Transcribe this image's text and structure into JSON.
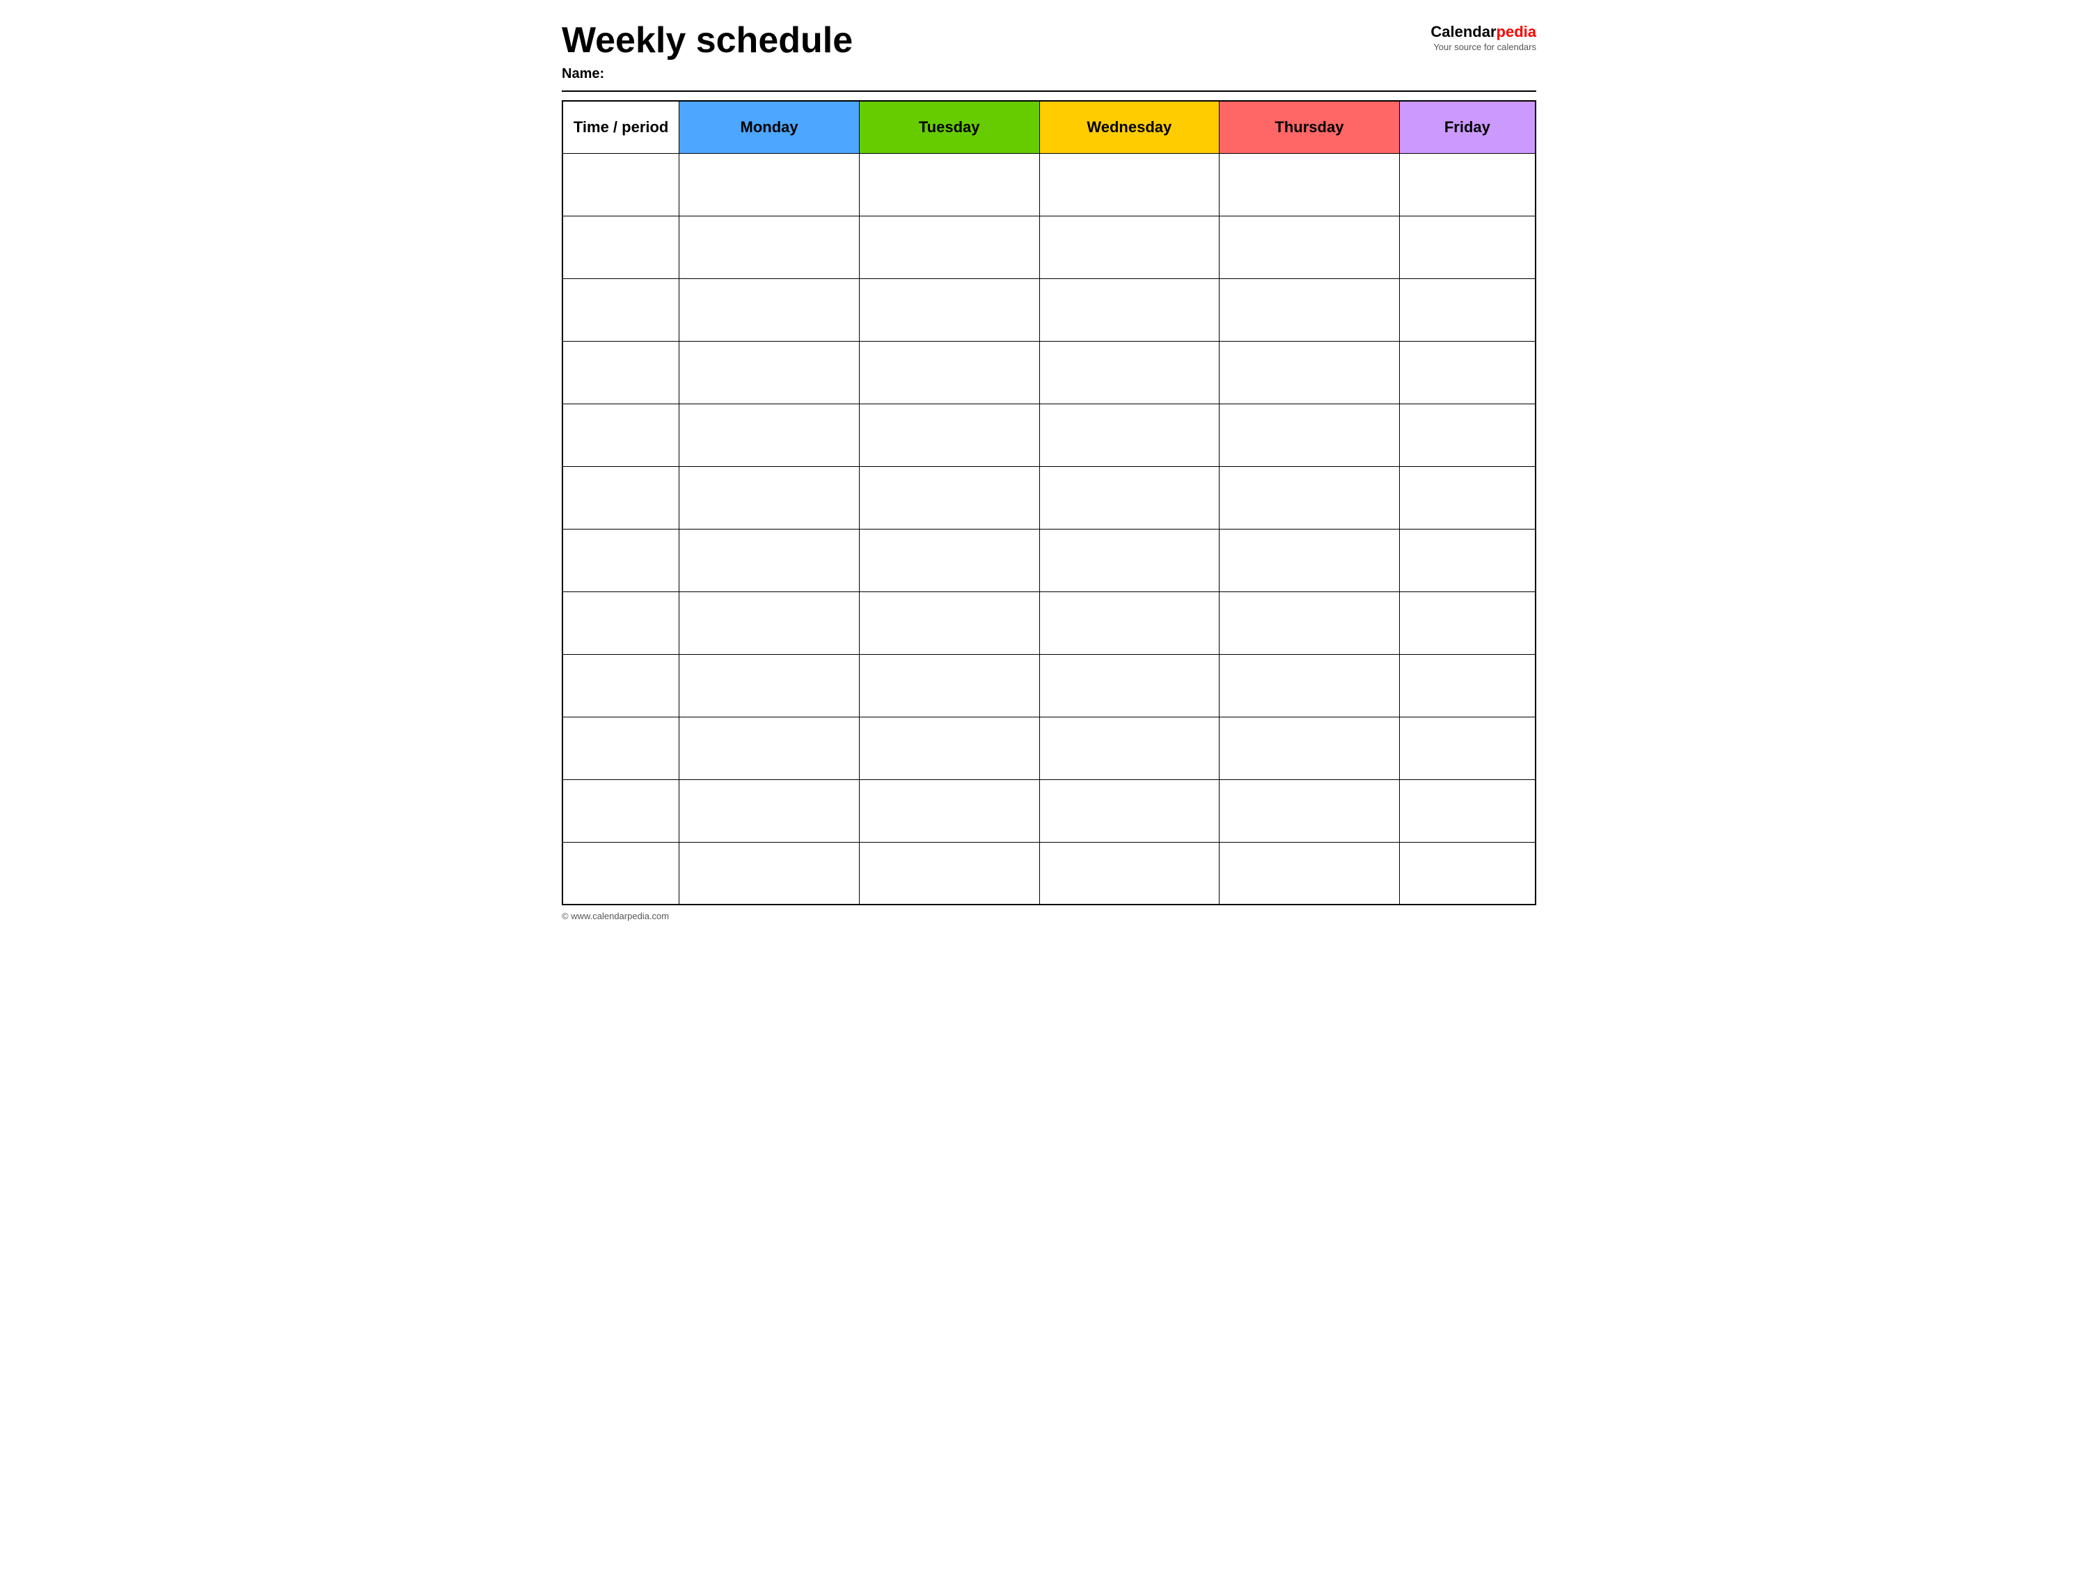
{
  "header": {
    "title": "Weekly schedule",
    "name_label": "Name:",
    "logo_calendar": "Calendar",
    "logo_pedia": "pedia",
    "logo_tagline": "Your source for calendars"
  },
  "table": {
    "columns": [
      {
        "id": "time",
        "label": "Time / period",
        "color": "#ffffff"
      },
      {
        "id": "monday",
        "label": "Monday",
        "color": "#4da6ff"
      },
      {
        "id": "tuesday",
        "label": "Tuesday",
        "color": "#66cc00"
      },
      {
        "id": "wednesday",
        "label": "Wednesday",
        "color": "#ffcc00"
      },
      {
        "id": "thursday",
        "label": "Thursday",
        "color": "#ff6666"
      },
      {
        "id": "friday",
        "label": "Friday",
        "color": "#cc99ff"
      }
    ],
    "row_count": 12
  },
  "footer": {
    "copyright": "© www.calendarpedia.com"
  }
}
